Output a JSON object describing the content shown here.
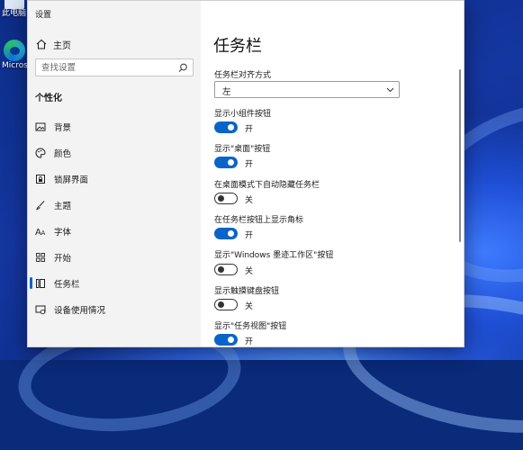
{
  "desktop": {
    "icons": [
      {
        "label": "此电脑"
      },
      {
        "label": "Microsoft Edge"
      }
    ]
  },
  "window": {
    "title": "设置",
    "controls": {
      "minimize": "—",
      "maximize": "☐",
      "close": "✕"
    }
  },
  "sidebar": {
    "home_label": "主页",
    "search_placeholder": "查找设置",
    "section_title": "个性化",
    "items": [
      {
        "label": "背景",
        "icon": "picture-icon"
      },
      {
        "label": "颜色",
        "icon": "palette-icon"
      },
      {
        "label": "锁屏界面",
        "icon": "lock-screen-icon"
      },
      {
        "label": "主题",
        "icon": "brush-icon"
      },
      {
        "label": "字体",
        "icon": "font-icon"
      },
      {
        "label": "开始",
        "icon": "start-icon"
      },
      {
        "label": "任务栏",
        "icon": "taskbar-icon",
        "active": true
      },
      {
        "label": "设备使用情况",
        "icon": "device-usage-icon"
      }
    ]
  },
  "content": {
    "title": "任务栏",
    "alignment": {
      "label": "任务栏对齐方式",
      "value": "左"
    },
    "settings": [
      {
        "label": "显示小组件按钮",
        "state": "开",
        "on": true
      },
      {
        "label": "显示\"桌面\"按钮",
        "state": "开",
        "on": true
      },
      {
        "label": "在桌面模式下自动隐藏任务栏",
        "state": "关",
        "on": false
      },
      {
        "label": "在任务栏按钮上显示角标",
        "state": "开",
        "on": true
      },
      {
        "label": "显示\"Windows 墨迹工作区\"按钮",
        "state": "关",
        "on": false
      },
      {
        "label": "显示触摸键盘按钮",
        "state": "关",
        "on": false
      },
      {
        "label": "显示\"任务视图\"按钮",
        "state": "开",
        "on": true
      }
    ]
  },
  "colors": {
    "accent": "#0a64c8"
  }
}
